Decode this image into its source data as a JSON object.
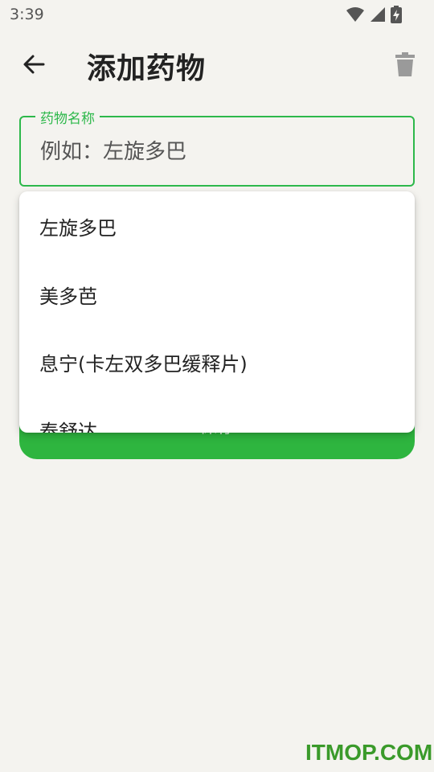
{
  "status_bar": {
    "time": "3:39"
  },
  "header": {
    "title": "添加药物",
    "back_icon": "arrow-left-icon",
    "delete_icon": "trash-icon"
  },
  "form": {
    "field_label": "药物名称",
    "field_placeholder": "例如：左旋多巴",
    "field_value": "",
    "save_label": "保存"
  },
  "suggestions": [
    "左旋多巴",
    "美多芭",
    "息宁(卡左双多巴缓释片)",
    "泰舒达"
  ],
  "watermark": "ITMOP.COM",
  "colors": {
    "accent": "#2db84b",
    "button": "#2eb53f",
    "background": "#f4f3ef"
  }
}
